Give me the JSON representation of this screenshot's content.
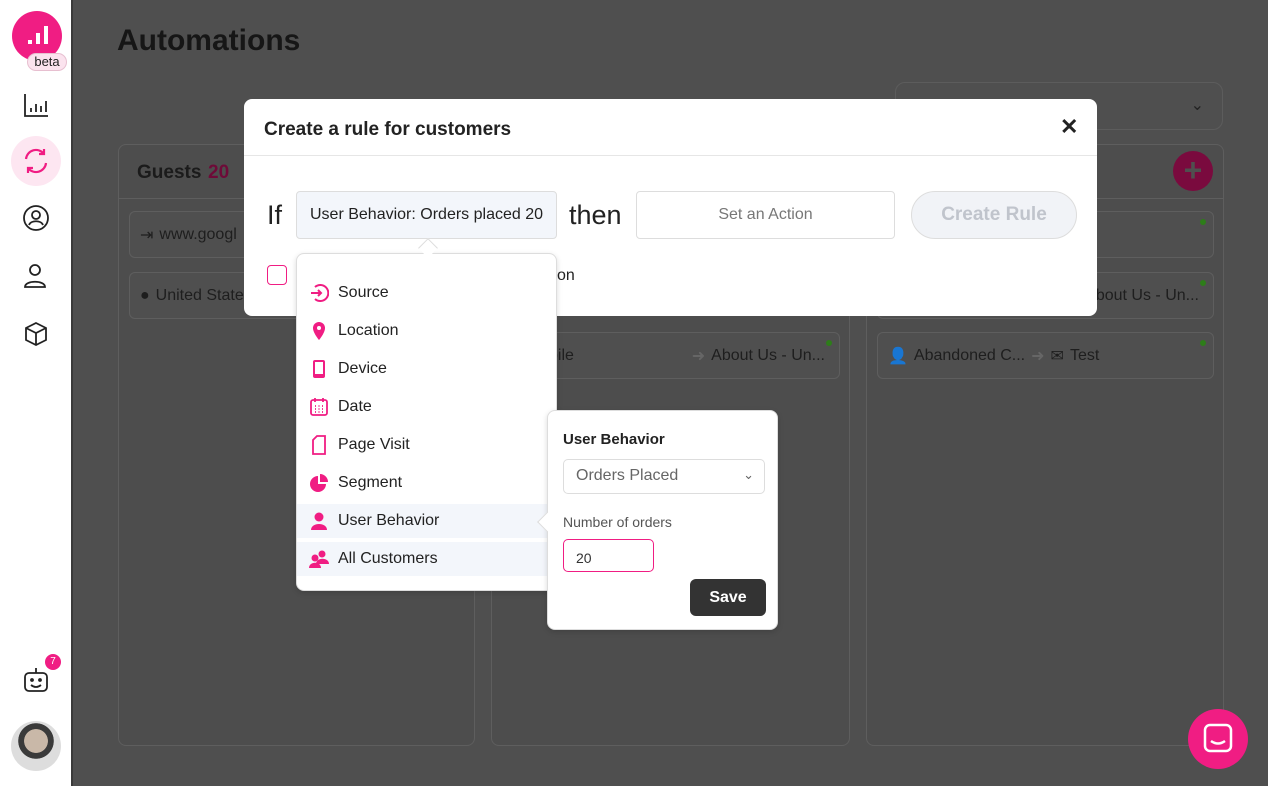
{
  "sidebar": {
    "beta": "beta",
    "notification_count": "7",
    "items": [
      "analytics",
      "automations",
      "audience",
      "users",
      "products"
    ]
  },
  "page": {
    "title": "Automations"
  },
  "columns": [
    {
      "title": "Guests",
      "count": "20",
      "cards": [
        {
          "from": "www.googl"
        },
        {
          "from": "United State"
        }
      ]
    },
    {
      "cards": [
        {
          "from": "bile",
          "to": "About Us - Un..."
        }
      ]
    },
    {
      "cards": [
        {
          "from": ""
        },
        {
          "from": "",
          "to": "bout Us - Un..."
        },
        {
          "from": "Abandoned C...",
          "to": "Test"
        }
      ]
    }
  ],
  "modal": {
    "title": "Create a rule for customers",
    "if_label": "If",
    "condition": "User Behavior: Orders placed 20",
    "then_label": "then",
    "action_placeholder": "Set an Action",
    "create_button": "Create Rule",
    "checkbox_label_fragment": "on"
  },
  "menu": {
    "items": [
      {
        "label": "Source",
        "icon": "source-icon"
      },
      {
        "label": "Location",
        "icon": "location-pin-icon"
      },
      {
        "label": "Device",
        "icon": "tablet-icon"
      },
      {
        "label": "Date",
        "icon": "calendar-icon"
      },
      {
        "label": "Page Visit",
        "icon": "page-icon"
      },
      {
        "label": "Segment",
        "icon": "pie-icon"
      },
      {
        "label": "User Behavior",
        "icon": "user-icon",
        "selected": true
      },
      {
        "label": "All Customers",
        "icon": "users-icon"
      }
    ]
  },
  "popover": {
    "title": "User Behavior",
    "select_value": "Orders Placed",
    "number_label": "Number of orders",
    "number_value": "20",
    "save": "Save"
  },
  "colors": {
    "accent": "#f01d83",
    "overlay": "#4f4f4f"
  }
}
